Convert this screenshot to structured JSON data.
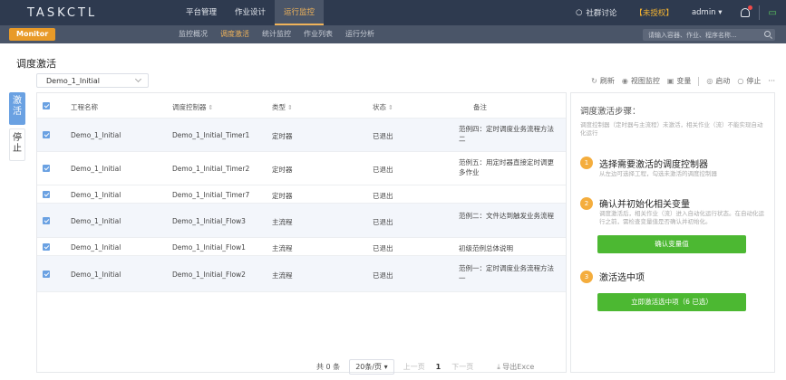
{
  "header": {
    "logo": "TASKCTL",
    "nav": [
      "平台管理",
      "作业设计",
      "运行监控"
    ],
    "community": "社群讨论",
    "unauthorized": "【未授权】",
    "user": "admin ▾",
    "chat_icon": "chat-icon"
  },
  "subbar": {
    "monitor_label": "Monitor",
    "nav": [
      "监控概况",
      "调度激活",
      "统计监控",
      "作业列表",
      "运行分析"
    ],
    "search_placeholder": "请输入容器、作业、程序名称..."
  },
  "page": {
    "title": "调度激活",
    "select_value": "Demo_1_Initial"
  },
  "toolbar": {
    "refresh": "刷新",
    "view_monitor": "视图监控",
    "variables": "变量",
    "start": "启动",
    "stop": "停止",
    "more": "···"
  },
  "side_tabs": {
    "activate": "激活",
    "stop": "停止"
  },
  "table": {
    "headers": [
      "工程名称",
      "调度控制器",
      "类型",
      "状态",
      "备注"
    ],
    "rows": [
      {
        "project": "Demo_1_Initial",
        "controller": "Demo_1_Initial_Timer1",
        "type": "定时器",
        "status": "已退出",
        "note": "范例四：定时调度业务流程方法二"
      },
      {
        "project": "Demo_1_Initial",
        "controller": "Demo_1_Initial_Timer2",
        "type": "定时器",
        "status": "已退出",
        "note": "范例五：用定时器直接定时调更多作业"
      },
      {
        "project": "Demo_1_Initial",
        "controller": "Demo_1_Initial_Timer7",
        "type": "定时器",
        "status": "已退出",
        "note": ""
      },
      {
        "project": "Demo_1_Initial",
        "controller": "Demo_1_Initial_Flow3",
        "type": "主流程",
        "status": "已退出",
        "note": "范例二：文件达到触发业务流程"
      },
      {
        "project": "Demo_1_Initial",
        "controller": "Demo_1_Initial_Flow1",
        "type": "主流程",
        "status": "已退出",
        "note": "初级范例总体说明"
      },
      {
        "project": "Demo_1_Initial",
        "controller": "Demo_1_Initial_Flow2",
        "type": "主流程",
        "status": "已退出",
        "note": "范例一：定时调度业务流程方法一"
      }
    ]
  },
  "pagination": {
    "total": "共 0 条",
    "page_size": "20条/页 ▾",
    "prev": "上一页",
    "current": "1",
    "next": "下一页",
    "export": "导出Exce"
  },
  "steps": {
    "title": "调度激活步骤：",
    "desc": "调度控制器（定时器与主流程）未激活，相关作业（流）不能实现自动化运行",
    "items": [
      {
        "num": "1",
        "title": "选择需要激活的调度控制器",
        "sub": "从左边可选择工程，勾选未激活的调度控制器",
        "button": ""
      },
      {
        "num": "2",
        "title": "确认并初始化相关变量",
        "sub": "调度激活后，相关作业（流）进入自动化运行状态。在自动化运行之前，需检查变量值是否确认并初始化。",
        "button": "确认变量值"
      },
      {
        "num": "3",
        "title": "激活选中项",
        "sub": "",
        "button": "立即激活选中项（6 已选）"
      }
    ]
  },
  "colors": {
    "header_bg": "#2e3a4f",
    "subbar_bg": "#4a5568",
    "accent_orange": "#f0b35a",
    "monitor_tag": "#e89a28",
    "blue": "#6aa1e2",
    "green": "#4cb832"
  }
}
